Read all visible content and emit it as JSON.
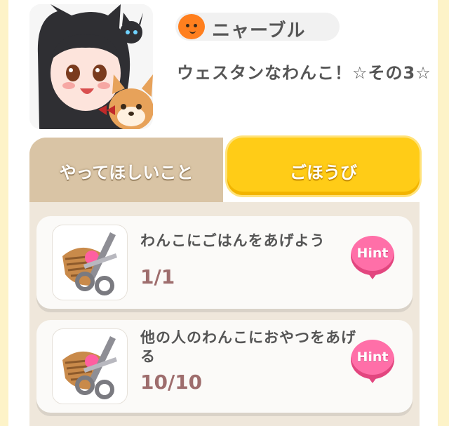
{
  "header": {
    "name": "ニャーブル",
    "title": "ウェスタンなわんこ！☆その3☆"
  },
  "tabs": [
    {
      "label": "やってほしいこと",
      "active": true
    },
    {
      "label": "ごほうび",
      "active": false
    }
  ],
  "tasks": [
    {
      "title": "わんこにごはんをあげよう",
      "progress": "1/1",
      "hint_label": "Hint",
      "icon": "brush-scissors-icon"
    },
    {
      "title": "他の人のわんこにおやつをあげる",
      "progress": "10/10",
      "hint_label": "Hint",
      "icon": "brush-scissors-icon"
    }
  ],
  "colors": {
    "active_tab": "#d9c4a5",
    "inactive_tab": "#ffcc17",
    "hint": "#ff6fa8",
    "progress_text": "#9e6d6d"
  }
}
